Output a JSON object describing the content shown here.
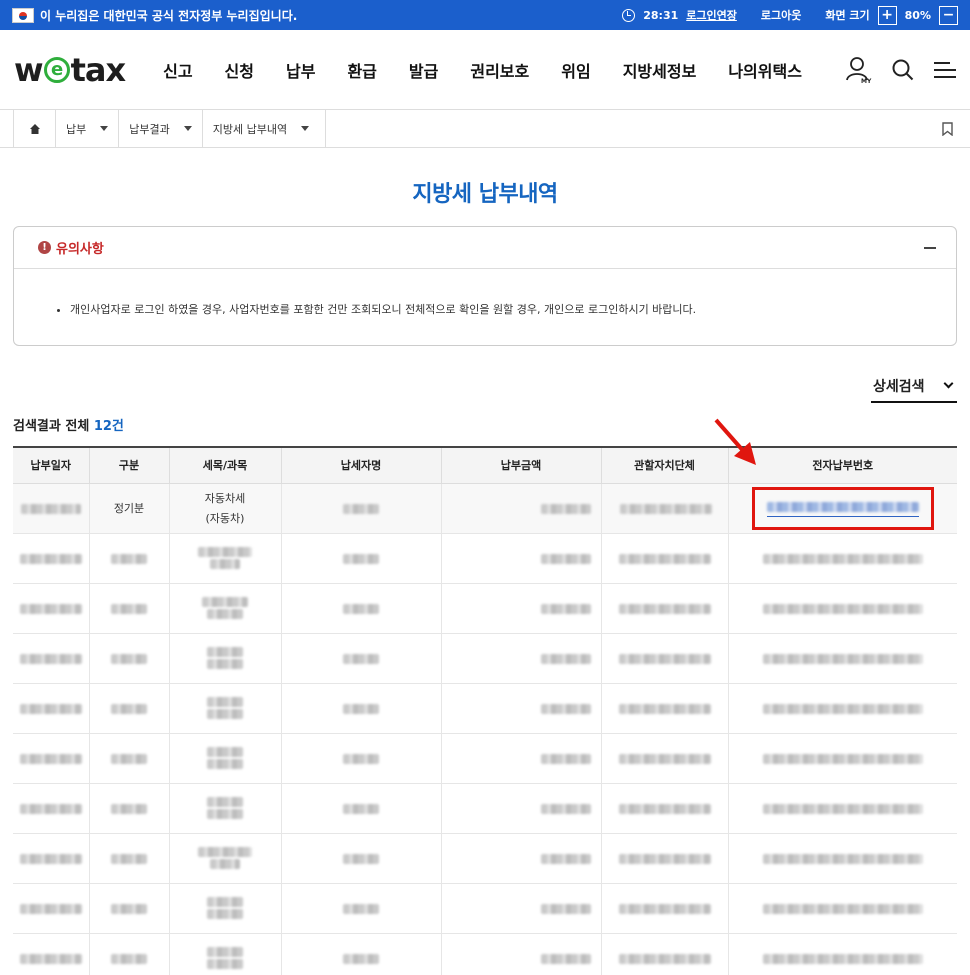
{
  "gov_banner": {
    "text": "이 누리집은 대한민국 공식 전자정부 누리집입니다.",
    "timer": "28:31",
    "extend_login": "로그인연장",
    "logout": "로그아웃",
    "screen_size": "화면 크기",
    "zoom_in": "+",
    "zoom_level": "80%",
    "zoom_out": "−"
  },
  "header": {
    "logo_prefix": "w",
    "logo_e": "e",
    "logo_suffix": "tax",
    "nav": [
      "신고",
      "신청",
      "납부",
      "환급",
      "발급",
      "권리보호",
      "위임",
      "지방세정보",
      "나의위택스"
    ],
    "my_label": "MY"
  },
  "breadcrumb": [
    "납부",
    "납부결과",
    "지방세 납부내역"
  ],
  "page_title": "지방세 납부내역",
  "notice": {
    "title": "유의사항",
    "items": [
      "개인사업자로 로그인 하였을 경우, 사업자번호를 포함한 건만 조회되오니 전체적으로 확인을 원할 경우, 개인으로 로그인하시기 바랍니다."
    ]
  },
  "detail_search": "상세검색",
  "result": {
    "prefix": "검색결과 전체 ",
    "count": "12건"
  },
  "table": {
    "headers": [
      "납부일자",
      "구분",
      "세목/과목",
      "납세자명",
      "납부금액",
      "관할자치단체",
      "전자납부번호"
    ],
    "first_row": {
      "type": "정기분",
      "tax_item_line1": "자동차세",
      "tax_item_line2": "(자동차)"
    }
  },
  "colors": {
    "gov_bar": "#1b5fcc",
    "title_blue": "#1565c0",
    "highlight_red": "#e0160f"
  }
}
